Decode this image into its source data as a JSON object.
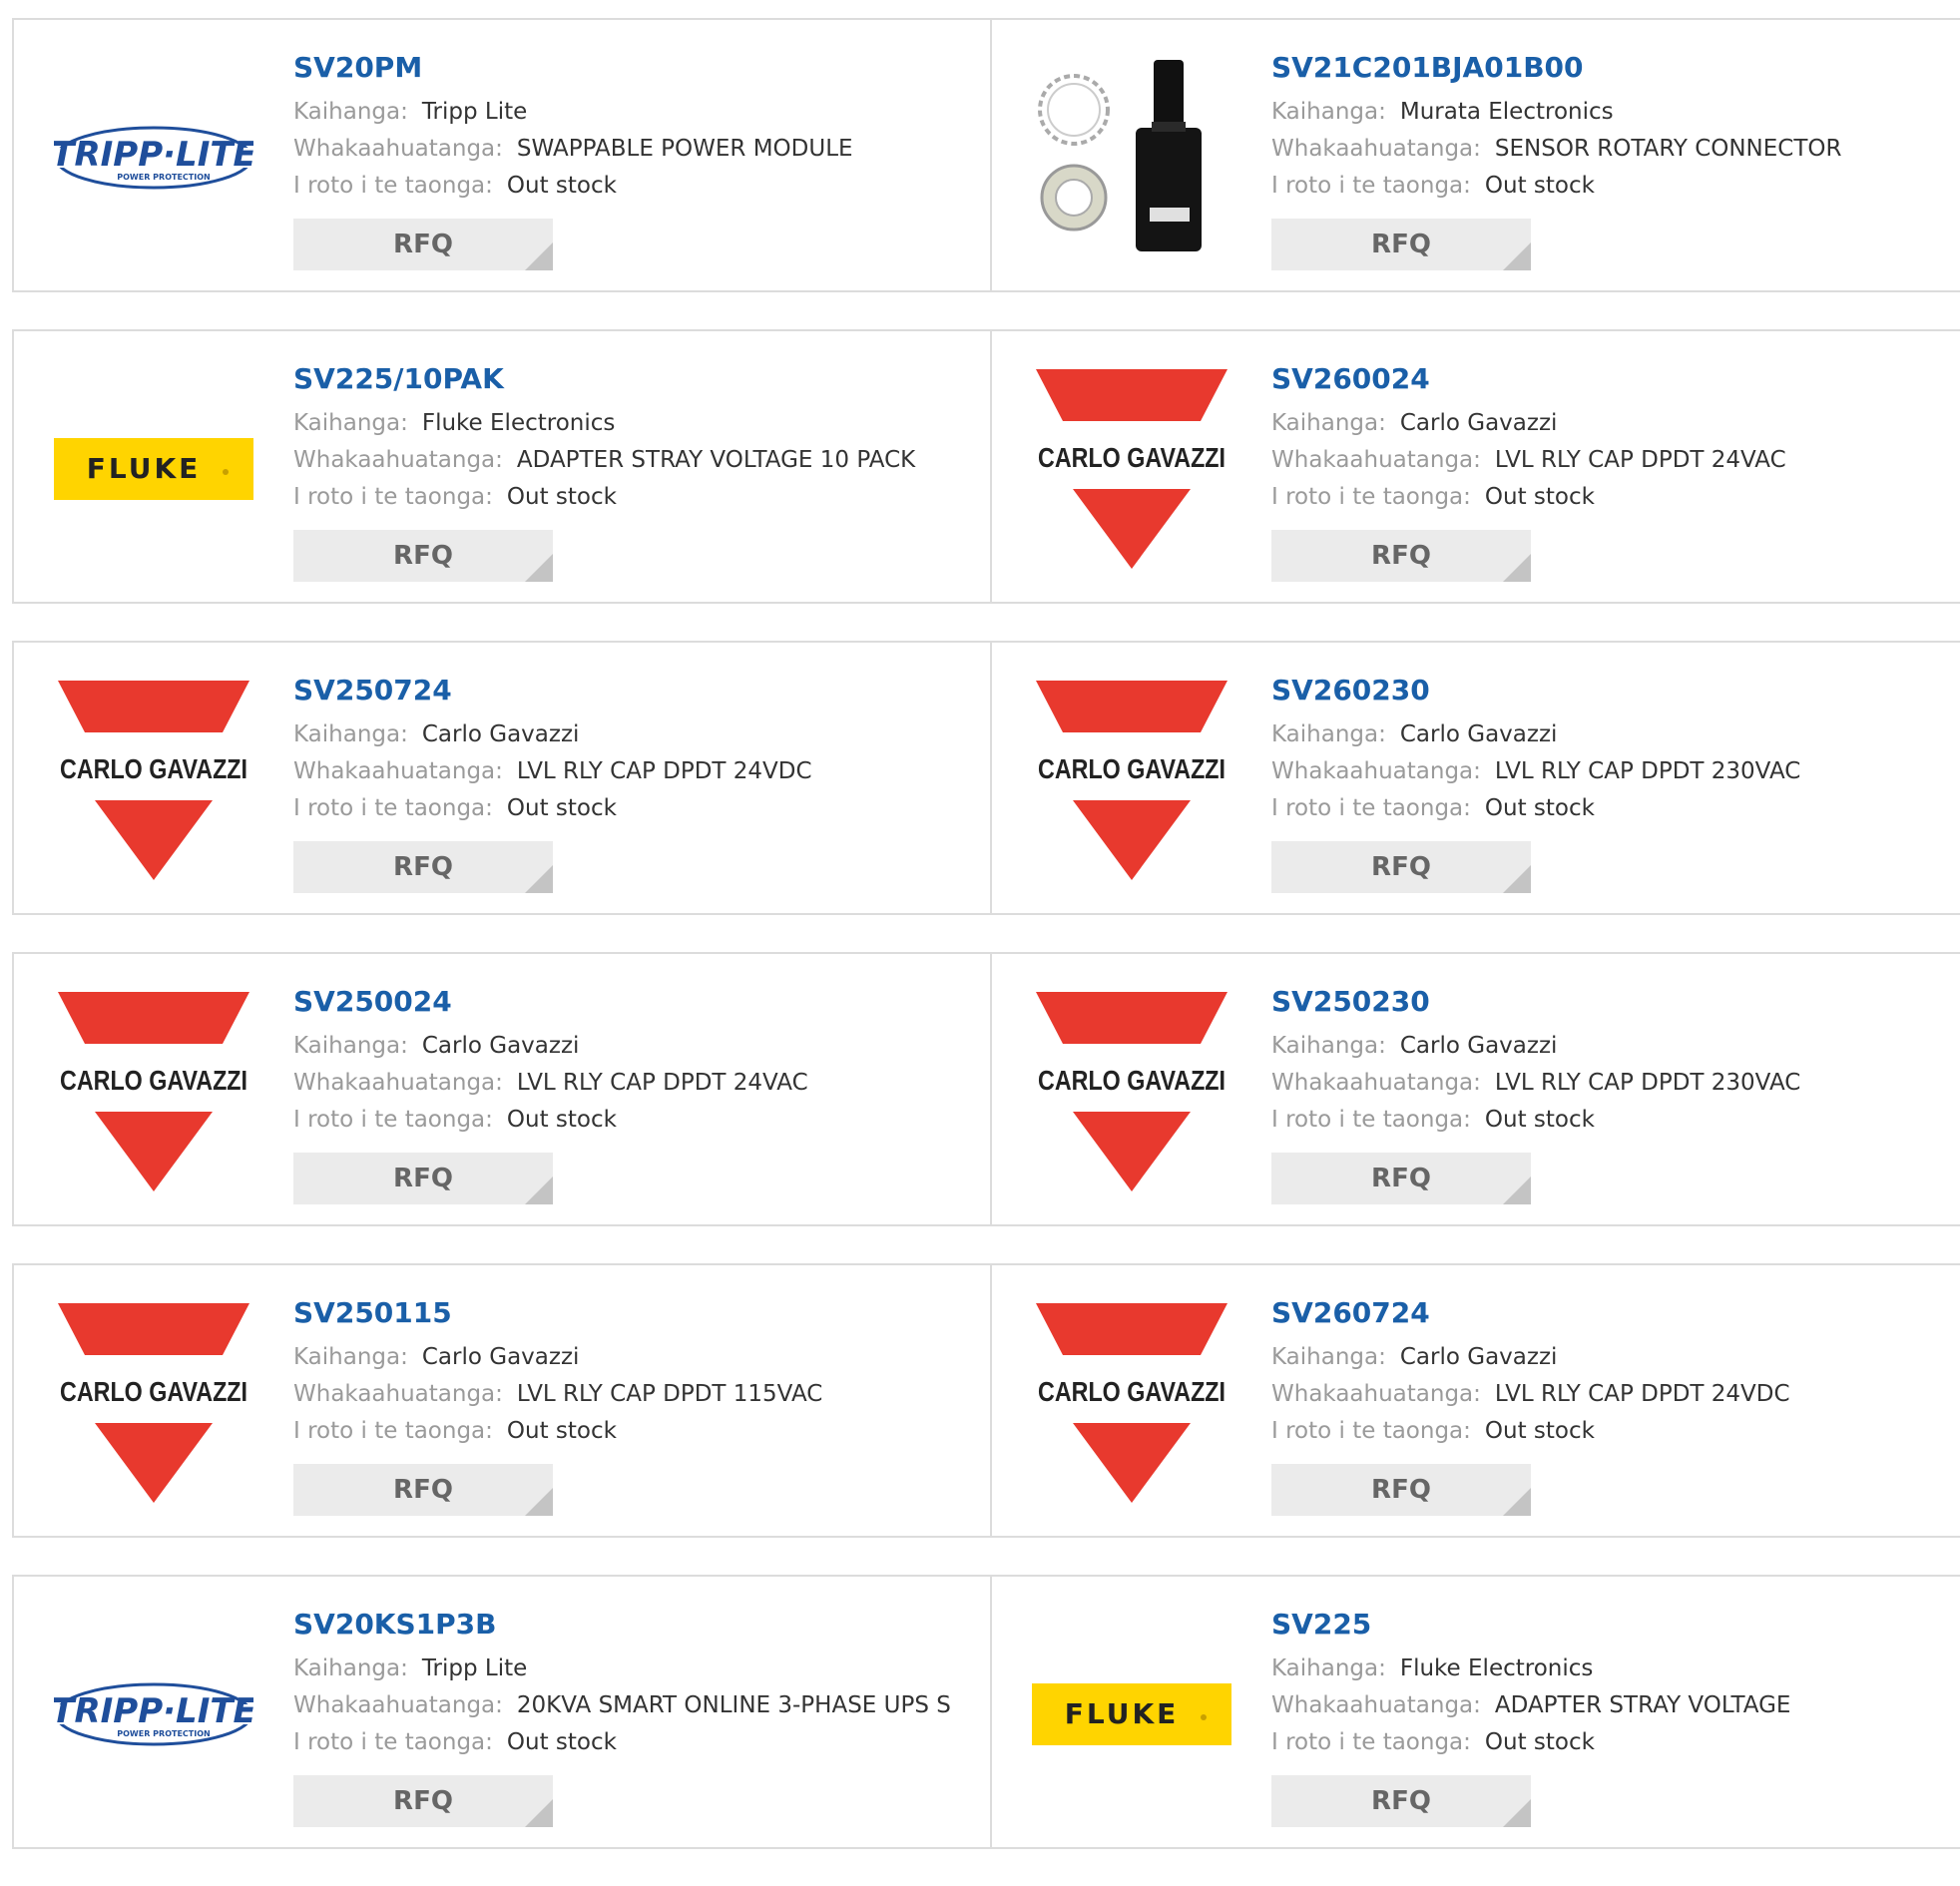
{
  "labels": {
    "manufacturer": "Kaihanga:",
    "description": "Whakaahuatanga:",
    "stock": "I roto i te taonga:",
    "rfq": "RFQ"
  },
  "logo_text": {
    "tripp_lite": "TRIPP·LITE",
    "tripp_lite_sub": "POWER PROTECTION",
    "fluke": "FLUKE",
    "carlo_gavazzi": "CARLO GAVAZZI"
  },
  "colors": {
    "part_number": "#1a5fa8",
    "fluke_yellow": "#ffd400",
    "carlo_red": "#e8392e",
    "tripp_blue": "#1f4e9b"
  },
  "products": [
    {
      "part": "SV20PM",
      "manufacturer": "Tripp Lite",
      "description": "SWAPPABLE POWER MODULE",
      "stock": "Out stock",
      "logo": "tripp_lite"
    },
    {
      "part": "SV21C201BJA01B00",
      "manufacturer": "Murata Electronics",
      "description": "SENSOR ROTARY CONNECTOR",
      "stock": "Out stock",
      "logo": "product_photo"
    },
    {
      "part": "SV225/10PAK",
      "manufacturer": "Fluke Electronics",
      "description": "ADAPTER STRAY VOLTAGE 10 PACK",
      "stock": "Out stock",
      "logo": "fluke"
    },
    {
      "part": "SV260024",
      "manufacturer": "Carlo Gavazzi",
      "description": "LVL RLY CAP DPDT 24VAC",
      "stock": "Out stock",
      "logo": "carlo_gavazzi"
    },
    {
      "part": "SV250724",
      "manufacturer": "Carlo Gavazzi",
      "description": "LVL RLY CAP DPDT 24VDC",
      "stock": "Out stock",
      "logo": "carlo_gavazzi"
    },
    {
      "part": "SV260230",
      "manufacturer": "Carlo Gavazzi",
      "description": "LVL RLY CAP DPDT 230VAC",
      "stock": "Out stock",
      "logo": "carlo_gavazzi"
    },
    {
      "part": "SV250024",
      "manufacturer": "Carlo Gavazzi",
      "description": "LVL RLY CAP DPDT 24VAC",
      "stock": "Out stock",
      "logo": "carlo_gavazzi"
    },
    {
      "part": "SV250230",
      "manufacturer": "Carlo Gavazzi",
      "description": "LVL RLY CAP DPDT 230VAC",
      "stock": "Out stock",
      "logo": "carlo_gavazzi"
    },
    {
      "part": "SV250115",
      "manufacturer": "Carlo Gavazzi",
      "description": "LVL RLY CAP DPDT 115VAC",
      "stock": "Out stock",
      "logo": "carlo_gavazzi"
    },
    {
      "part": "SV260724",
      "manufacturer": "Carlo Gavazzi",
      "description": "LVL RLY CAP DPDT 24VDC",
      "stock": "Out stock",
      "logo": "carlo_gavazzi"
    },
    {
      "part": "SV20KS1P3B",
      "manufacturer": "Tripp Lite",
      "description": "20KVA SMART ONLINE 3-PHASE UPS S",
      "stock": "Out stock",
      "logo": "tripp_lite"
    },
    {
      "part": "SV225",
      "manufacturer": "Fluke Electronics",
      "description": "ADAPTER STRAY VOLTAGE",
      "stock": "Out stock",
      "logo": "fluke"
    }
  ]
}
